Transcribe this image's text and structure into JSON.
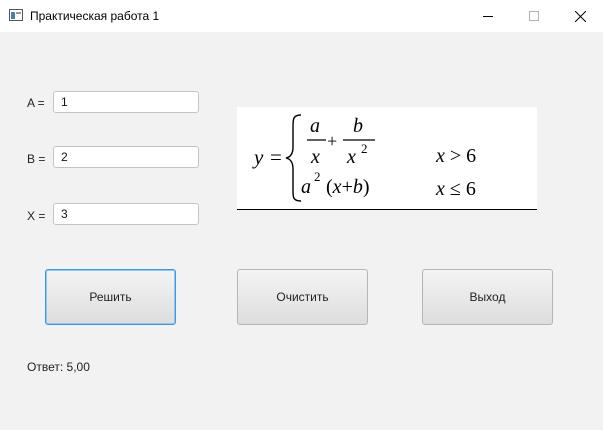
{
  "window": {
    "title": "Практическая работа 1",
    "controls": [
      "minimize-icon",
      "maximize-icon",
      "close-icon"
    ]
  },
  "inputs": [
    {
      "label": "A =",
      "value": "1"
    },
    {
      "label": "B =",
      "value": "2"
    },
    {
      "label": "X =",
      "value": "3"
    }
  ],
  "formula": {
    "lhs": "y =",
    "case1_expr": "a/x + b/x²",
    "case1_cond": "x > 6",
    "case2_expr": "a²(x+b)",
    "case2_cond": "x ≤ 6"
  },
  "buttons": {
    "solve": "Решить",
    "clear": "Очистить",
    "exit": "Выход"
  },
  "answer": {
    "label": "Ответ:",
    "value": "5,00"
  }
}
